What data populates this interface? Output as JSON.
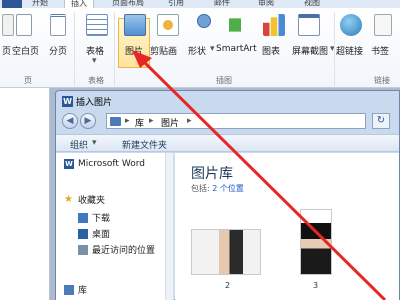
{
  "ribbon": {
    "tabs": [
      "开始",
      "插入",
      "页面布局",
      "引用",
      "邮件",
      "审阅",
      "视图"
    ],
    "active_tab": "插入",
    "buttons": {
      "cover": "页",
      "blank_page": "空白页",
      "page_break": "分页",
      "table": "表格",
      "picture": "图片",
      "clipart": "剪贴画",
      "shapes": "形状",
      "smartart": "SmartArt",
      "chart": "图表",
      "screenshot": "屏幕截图",
      "hyperlink": "超链接",
      "bookmark": "书签"
    },
    "groups": {
      "pages": "页",
      "tables": "表格",
      "illustrations": "插图",
      "links": "链接"
    }
  },
  "dialog": {
    "title": "插入图片",
    "breadcrumb": [
      "库",
      "图片"
    ],
    "organize": "组织",
    "new_folder": "新建文件夹",
    "nav": {
      "word": "Microsoft Word",
      "favorites": "收藏夹",
      "downloads": "下载",
      "desktop": "桌面",
      "recent": "最近访问的位置",
      "library": "库"
    },
    "library_title": "图片库",
    "library_includes": "包括:",
    "library_count": "2 个位置",
    "thumbs": [
      "2",
      "3"
    ]
  },
  "colors": {
    "accent": "#2b5797",
    "arrow": "#e8262a",
    "highlight": "#ffe49a"
  }
}
